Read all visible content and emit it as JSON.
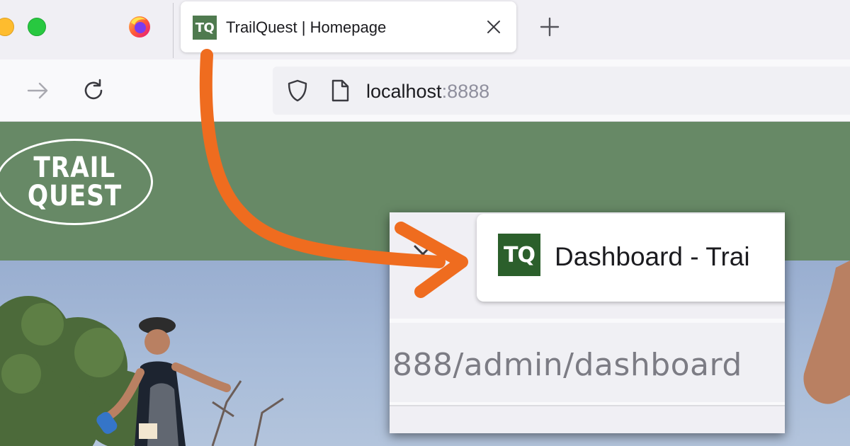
{
  "browser": {
    "tab": {
      "favicon_text": "TQ",
      "title": "TrailQuest | Homepage"
    },
    "url": {
      "host": "localhost",
      "port": ":8888"
    }
  },
  "site": {
    "logo": {
      "line1": "TRAIL",
      "line2": "QUEST"
    },
    "header_color": "#678966"
  },
  "callout": {
    "tab": {
      "favicon_text": "TQ",
      "title": "Dashboard - Trai"
    },
    "url_fragment": "888/admin/dashboard"
  },
  "icons": {
    "browser_logo": "firefox-icon",
    "tab_close": "close-icon",
    "new_tab": "plus-icon",
    "forward": "arrow-right-icon",
    "reload": "reload-icon",
    "tracking": "shield-icon",
    "page": "page-icon"
  },
  "colors": {
    "annotation_arrow": "#ef6c1f",
    "favicon_bg": "#4f7a4f",
    "callout_favicon_bg": "#2b5f2b"
  }
}
